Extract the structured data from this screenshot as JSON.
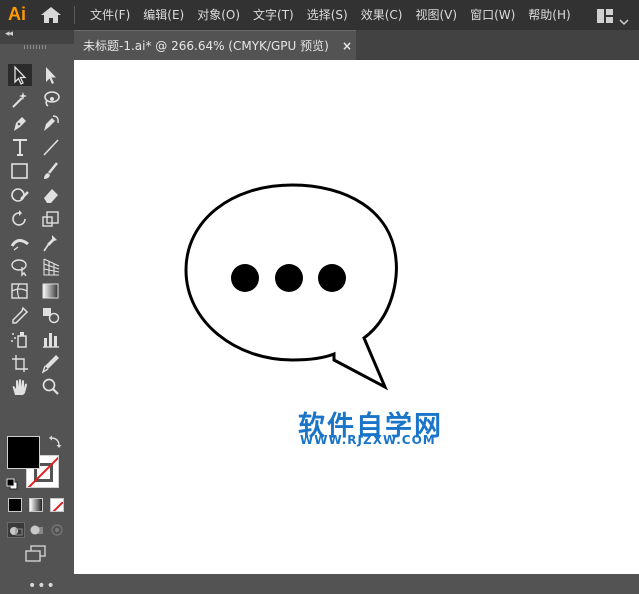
{
  "app": {
    "logo": "Ai"
  },
  "menu": [
    "文件(F)",
    "编辑(E)",
    "对象(O)",
    "文字(T)",
    "选择(S)",
    "效果(C)",
    "视图(V)",
    "窗口(W)",
    "帮助(H)"
  ],
  "tab": {
    "title": "未标题-1.ai* @ 266.64% (CMYK/GPU 预览)",
    "close": "×"
  },
  "tools_panel": {
    "collapse": "◂◂",
    "more": "•••"
  },
  "colors": {
    "fill": "#000000",
    "stroke": "none",
    "accent": "#ff9a00",
    "watermark": "#1a75c8"
  },
  "watermark": {
    "title": "软件自学网",
    "url": "WWW.RJZXW.COM"
  }
}
